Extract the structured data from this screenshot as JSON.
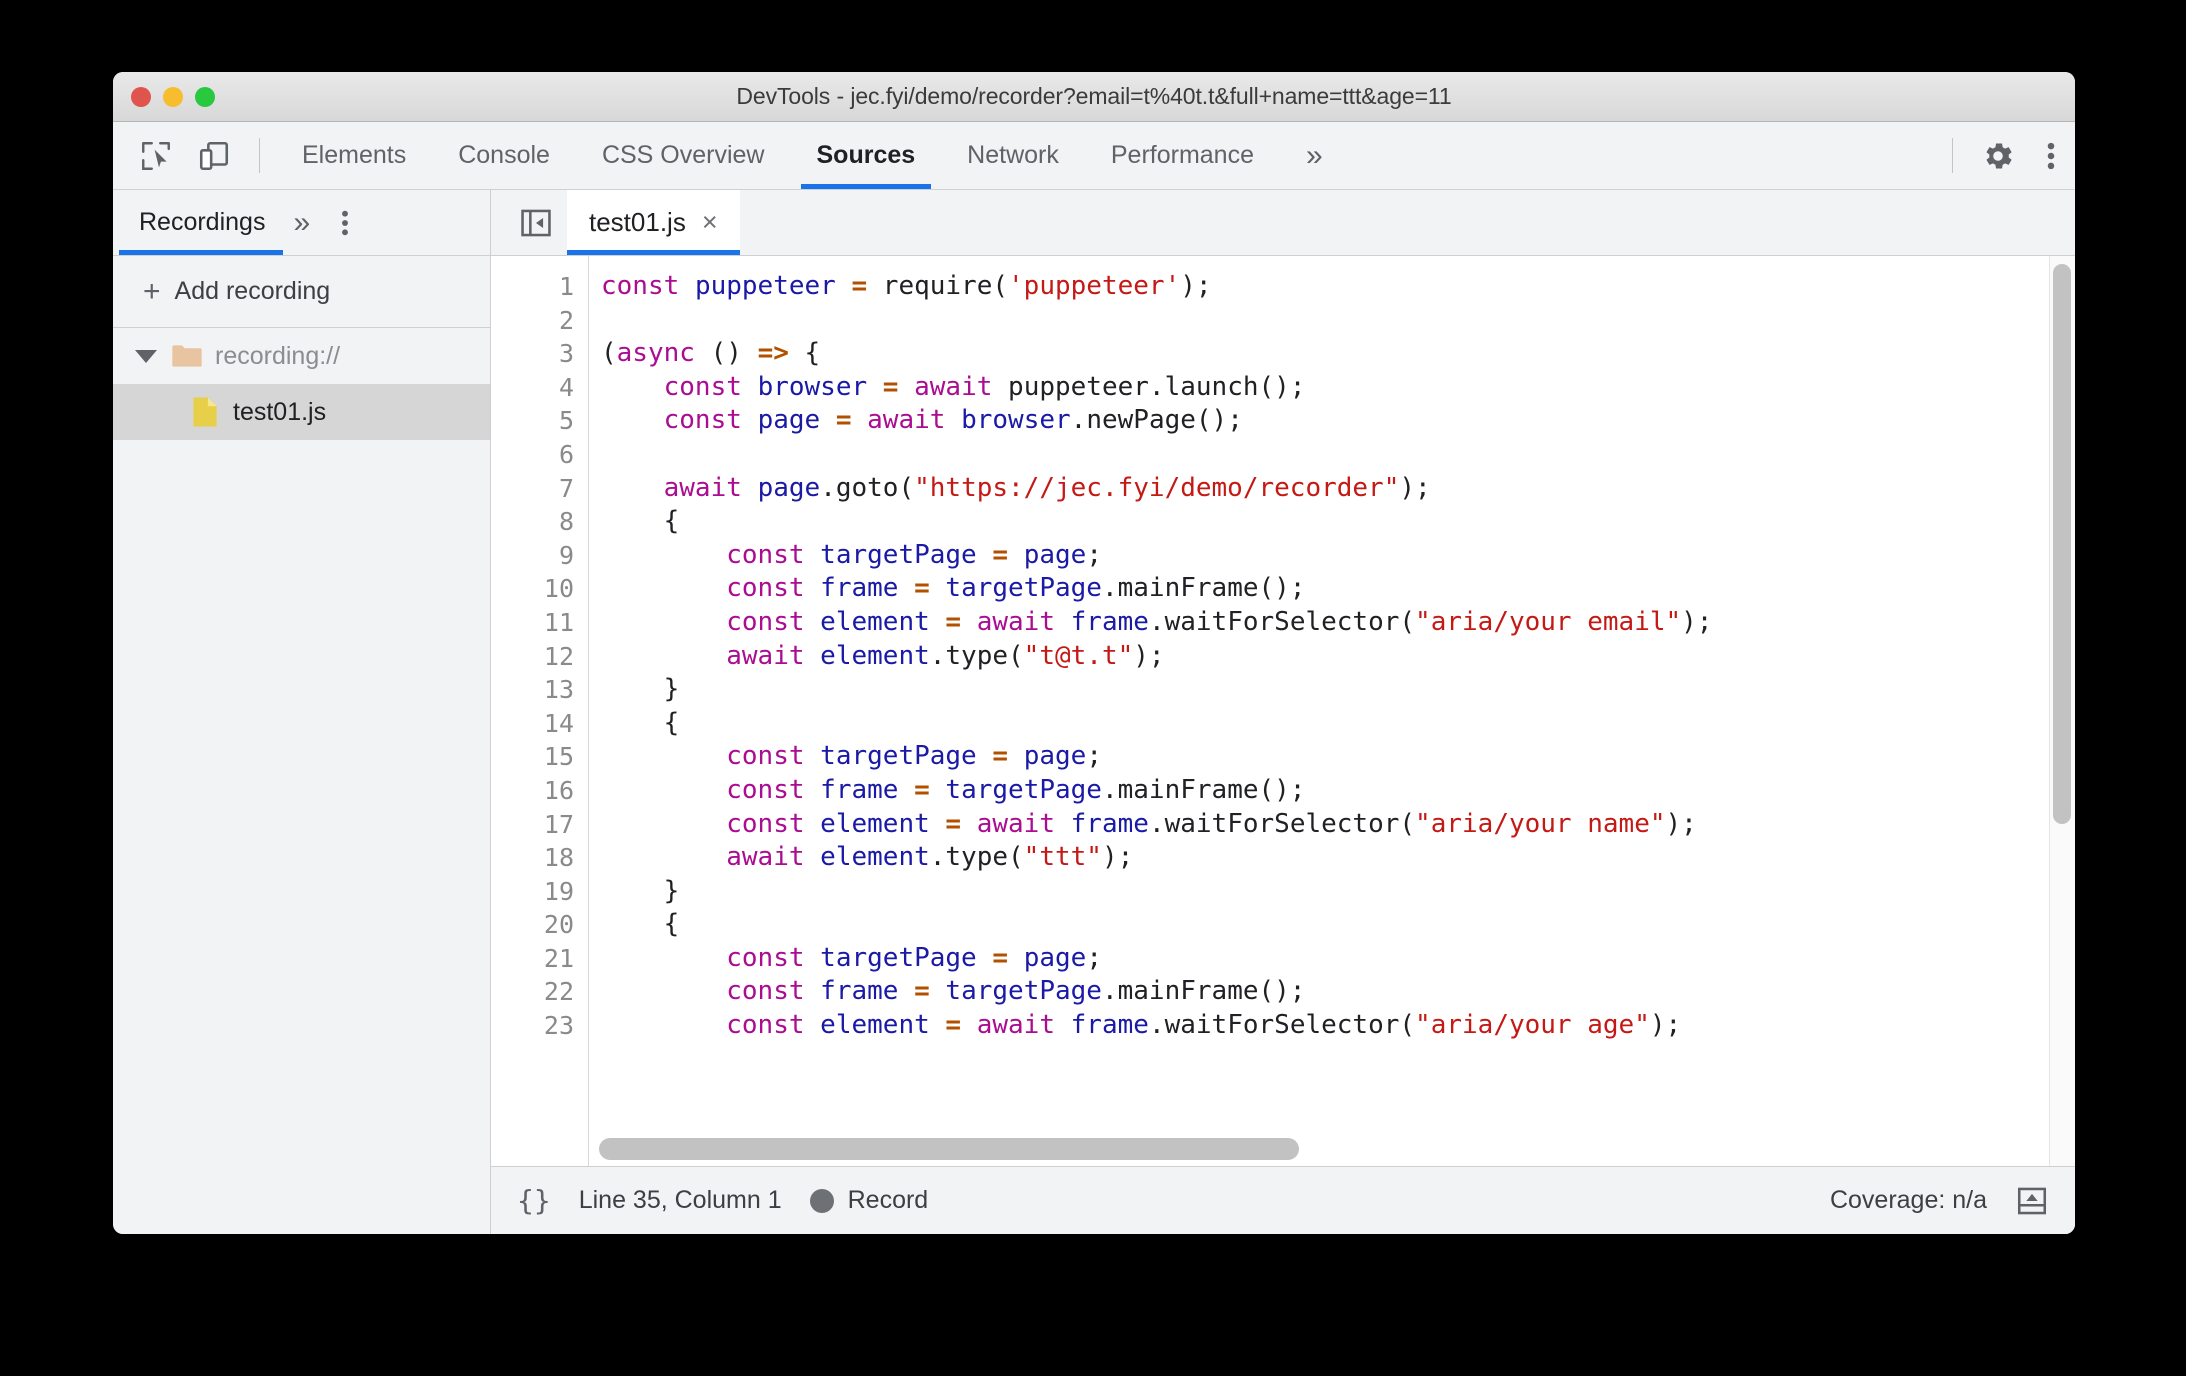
{
  "window": {
    "title": "DevTools - jec.fyi/demo/recorder?email=t%40t.t&full+name=ttt&age=11",
    "traffic_lights": [
      "close",
      "minimize",
      "zoom"
    ]
  },
  "devtools_tabs": {
    "icons": [
      "inspect-element-icon",
      "device-toolbar-icon"
    ],
    "items": [
      {
        "label": "Elements",
        "active": false
      },
      {
        "label": "Console",
        "active": false
      },
      {
        "label": "CSS Overview",
        "active": false
      },
      {
        "label": "Sources",
        "active": true
      },
      {
        "label": "Network",
        "active": false
      },
      {
        "label": "Performance",
        "active": false
      }
    ],
    "more_label": "»",
    "settings_icon": "gear-icon",
    "menu_icon": "more-vertical-icon"
  },
  "sidebar": {
    "tab_label": "Recordings",
    "more_label": "»",
    "menu_icon": "more-vertical-icon",
    "add_recording_label": "Add recording",
    "add_recording_glyph": "+",
    "tree": [
      {
        "label": "recording://",
        "type": "folder",
        "expanded": true
      },
      {
        "label": "test01.js",
        "type": "file",
        "selected": true
      }
    ]
  },
  "editor": {
    "sidebar_toggle_icon": "show-navigator-icon",
    "tab_name": "test01.js",
    "close_glyph": "×",
    "lines": [
      {
        "n": "1",
        "tokens": [
          {
            "t": "const",
            "c": "kw"
          },
          {
            "t": " ",
            "c": "pln"
          },
          {
            "t": "puppeteer",
            "c": "var"
          },
          {
            "t": " ",
            "c": "pln"
          },
          {
            "t": "=",
            "c": "op"
          },
          {
            "t": " require(",
            "c": "pln"
          },
          {
            "t": "'puppeteer'",
            "c": "str"
          },
          {
            "t": ");",
            "c": "pln"
          }
        ]
      },
      {
        "n": "2",
        "tokens": []
      },
      {
        "n": "3",
        "tokens": [
          {
            "t": "(",
            "c": "pln"
          },
          {
            "t": "async",
            "c": "kw"
          },
          {
            "t": " () ",
            "c": "pln"
          },
          {
            "t": "=>",
            "c": "op"
          },
          {
            "t": " {",
            "c": "pln"
          }
        ]
      },
      {
        "n": "4",
        "tokens": [
          {
            "t": "    ",
            "c": "pln"
          },
          {
            "t": "const",
            "c": "kw"
          },
          {
            "t": " ",
            "c": "pln"
          },
          {
            "t": "browser",
            "c": "var"
          },
          {
            "t": " ",
            "c": "pln"
          },
          {
            "t": "=",
            "c": "op"
          },
          {
            "t": " ",
            "c": "pln"
          },
          {
            "t": "await",
            "c": "kw"
          },
          {
            "t": " puppeteer.launch();",
            "c": "pln"
          }
        ]
      },
      {
        "n": "5",
        "tokens": [
          {
            "t": "    ",
            "c": "pln"
          },
          {
            "t": "const",
            "c": "kw"
          },
          {
            "t": " ",
            "c": "pln"
          },
          {
            "t": "page",
            "c": "var"
          },
          {
            "t": " ",
            "c": "pln"
          },
          {
            "t": "=",
            "c": "op"
          },
          {
            "t": " ",
            "c": "pln"
          },
          {
            "t": "await",
            "c": "kw"
          },
          {
            "t": " ",
            "c": "pln"
          },
          {
            "t": "browser",
            "c": "var"
          },
          {
            "t": ".newPage();",
            "c": "pln"
          }
        ]
      },
      {
        "n": "6",
        "tokens": []
      },
      {
        "n": "7",
        "tokens": [
          {
            "t": "    ",
            "c": "pln"
          },
          {
            "t": "await",
            "c": "kw"
          },
          {
            "t": " ",
            "c": "pln"
          },
          {
            "t": "page",
            "c": "var"
          },
          {
            "t": ".goto(",
            "c": "pln"
          },
          {
            "t": "\"https://jec.fyi/demo/recorder\"",
            "c": "str"
          },
          {
            "t": ");",
            "c": "pln"
          }
        ]
      },
      {
        "n": "8",
        "tokens": [
          {
            "t": "    {",
            "c": "pln"
          }
        ]
      },
      {
        "n": "9",
        "tokens": [
          {
            "t": "        ",
            "c": "pln"
          },
          {
            "t": "const",
            "c": "kw"
          },
          {
            "t": " ",
            "c": "pln"
          },
          {
            "t": "targetPage",
            "c": "var"
          },
          {
            "t": " ",
            "c": "pln"
          },
          {
            "t": "=",
            "c": "op"
          },
          {
            "t": " ",
            "c": "pln"
          },
          {
            "t": "page",
            "c": "var"
          },
          {
            "t": ";",
            "c": "pln"
          }
        ]
      },
      {
        "n": "10",
        "tokens": [
          {
            "t": "        ",
            "c": "pln"
          },
          {
            "t": "const",
            "c": "kw"
          },
          {
            "t": " ",
            "c": "pln"
          },
          {
            "t": "frame",
            "c": "var"
          },
          {
            "t": " ",
            "c": "pln"
          },
          {
            "t": "=",
            "c": "op"
          },
          {
            "t": " ",
            "c": "pln"
          },
          {
            "t": "targetPage",
            "c": "var"
          },
          {
            "t": ".mainFrame();",
            "c": "pln"
          }
        ]
      },
      {
        "n": "11",
        "tokens": [
          {
            "t": "        ",
            "c": "pln"
          },
          {
            "t": "const",
            "c": "kw"
          },
          {
            "t": " ",
            "c": "pln"
          },
          {
            "t": "element",
            "c": "var"
          },
          {
            "t": " ",
            "c": "pln"
          },
          {
            "t": "=",
            "c": "op"
          },
          {
            "t": " ",
            "c": "pln"
          },
          {
            "t": "await",
            "c": "kw"
          },
          {
            "t": " ",
            "c": "pln"
          },
          {
            "t": "frame",
            "c": "var"
          },
          {
            "t": ".waitForSelector(",
            "c": "pln"
          },
          {
            "t": "\"aria/your email\"",
            "c": "str"
          },
          {
            "t": ");",
            "c": "pln"
          }
        ]
      },
      {
        "n": "12",
        "tokens": [
          {
            "t": "        ",
            "c": "pln"
          },
          {
            "t": "await",
            "c": "kw"
          },
          {
            "t": " ",
            "c": "pln"
          },
          {
            "t": "element",
            "c": "var"
          },
          {
            "t": ".type(",
            "c": "pln"
          },
          {
            "t": "\"t@t.t\"",
            "c": "str"
          },
          {
            "t": ");",
            "c": "pln"
          }
        ]
      },
      {
        "n": "13",
        "tokens": [
          {
            "t": "    }",
            "c": "pln"
          }
        ]
      },
      {
        "n": "14",
        "tokens": [
          {
            "t": "    {",
            "c": "pln"
          }
        ]
      },
      {
        "n": "15",
        "tokens": [
          {
            "t": "        ",
            "c": "pln"
          },
          {
            "t": "const",
            "c": "kw"
          },
          {
            "t": " ",
            "c": "pln"
          },
          {
            "t": "targetPage",
            "c": "var"
          },
          {
            "t": " ",
            "c": "pln"
          },
          {
            "t": "=",
            "c": "op"
          },
          {
            "t": " ",
            "c": "pln"
          },
          {
            "t": "page",
            "c": "var"
          },
          {
            "t": ";",
            "c": "pln"
          }
        ]
      },
      {
        "n": "16",
        "tokens": [
          {
            "t": "        ",
            "c": "pln"
          },
          {
            "t": "const",
            "c": "kw"
          },
          {
            "t": " ",
            "c": "pln"
          },
          {
            "t": "frame",
            "c": "var"
          },
          {
            "t": " ",
            "c": "pln"
          },
          {
            "t": "=",
            "c": "op"
          },
          {
            "t": " ",
            "c": "pln"
          },
          {
            "t": "targetPage",
            "c": "var"
          },
          {
            "t": ".mainFrame();",
            "c": "pln"
          }
        ]
      },
      {
        "n": "17",
        "tokens": [
          {
            "t": "        ",
            "c": "pln"
          },
          {
            "t": "const",
            "c": "kw"
          },
          {
            "t": " ",
            "c": "pln"
          },
          {
            "t": "element",
            "c": "var"
          },
          {
            "t": " ",
            "c": "pln"
          },
          {
            "t": "=",
            "c": "op"
          },
          {
            "t": " ",
            "c": "pln"
          },
          {
            "t": "await",
            "c": "kw"
          },
          {
            "t": " ",
            "c": "pln"
          },
          {
            "t": "frame",
            "c": "var"
          },
          {
            "t": ".waitForSelector(",
            "c": "pln"
          },
          {
            "t": "\"aria/your name\"",
            "c": "str"
          },
          {
            "t": ");",
            "c": "pln"
          }
        ]
      },
      {
        "n": "18",
        "tokens": [
          {
            "t": "        ",
            "c": "pln"
          },
          {
            "t": "await",
            "c": "kw"
          },
          {
            "t": " ",
            "c": "pln"
          },
          {
            "t": "element",
            "c": "var"
          },
          {
            "t": ".type(",
            "c": "pln"
          },
          {
            "t": "\"ttt\"",
            "c": "str"
          },
          {
            "t": ");",
            "c": "pln"
          }
        ]
      },
      {
        "n": "19",
        "tokens": [
          {
            "t": "    }",
            "c": "pln"
          }
        ]
      },
      {
        "n": "20",
        "tokens": [
          {
            "t": "    {",
            "c": "pln"
          }
        ]
      },
      {
        "n": "21",
        "tokens": [
          {
            "t": "        ",
            "c": "pln"
          },
          {
            "t": "const",
            "c": "kw"
          },
          {
            "t": " ",
            "c": "pln"
          },
          {
            "t": "targetPage",
            "c": "var"
          },
          {
            "t": " ",
            "c": "pln"
          },
          {
            "t": "=",
            "c": "op"
          },
          {
            "t": " ",
            "c": "pln"
          },
          {
            "t": "page",
            "c": "var"
          },
          {
            "t": ";",
            "c": "pln"
          }
        ]
      },
      {
        "n": "22",
        "tokens": [
          {
            "t": "        ",
            "c": "pln"
          },
          {
            "t": "const",
            "c": "kw"
          },
          {
            "t": " ",
            "c": "pln"
          },
          {
            "t": "frame",
            "c": "var"
          },
          {
            "t": " ",
            "c": "pln"
          },
          {
            "t": "=",
            "c": "op"
          },
          {
            "t": " ",
            "c": "pln"
          },
          {
            "t": "targetPage",
            "c": "var"
          },
          {
            "t": ".mainFrame();",
            "c": "pln"
          }
        ]
      },
      {
        "n": "23",
        "tokens": [
          {
            "t": "        ",
            "c": "pln"
          },
          {
            "t": "const",
            "c": "kw"
          },
          {
            "t": " ",
            "c": "pln"
          },
          {
            "t": "element",
            "c": "var"
          },
          {
            "t": " ",
            "c": "pln"
          },
          {
            "t": "=",
            "c": "op"
          },
          {
            "t": " ",
            "c": "pln"
          },
          {
            "t": "await",
            "c": "kw"
          },
          {
            "t": " ",
            "c": "pln"
          },
          {
            "t": "frame",
            "c": "var"
          },
          {
            "t": ".waitForSelector(",
            "c": "pln"
          },
          {
            "t": "\"aria/your age\"",
            "c": "str"
          },
          {
            "t": ");",
            "c": "pln"
          }
        ]
      }
    ]
  },
  "statusbar": {
    "format_glyph": "{}",
    "cursor_position": "Line 35, Column 1",
    "record_label": "Record",
    "coverage": "Coverage: n/a",
    "drawer_icon": "show-drawer-icon"
  },
  "colors": {
    "accent": "#1a73e8",
    "chrome_bg": "#f1f3f4",
    "keyword": "#aa0d91",
    "variable": "#1a1aa6",
    "string": "#c41a16",
    "operator": "#b35000",
    "selected_row": "#d6d6d6",
    "folder_icon": "#e8c4a0",
    "file_icon": "#e8cf4a"
  }
}
